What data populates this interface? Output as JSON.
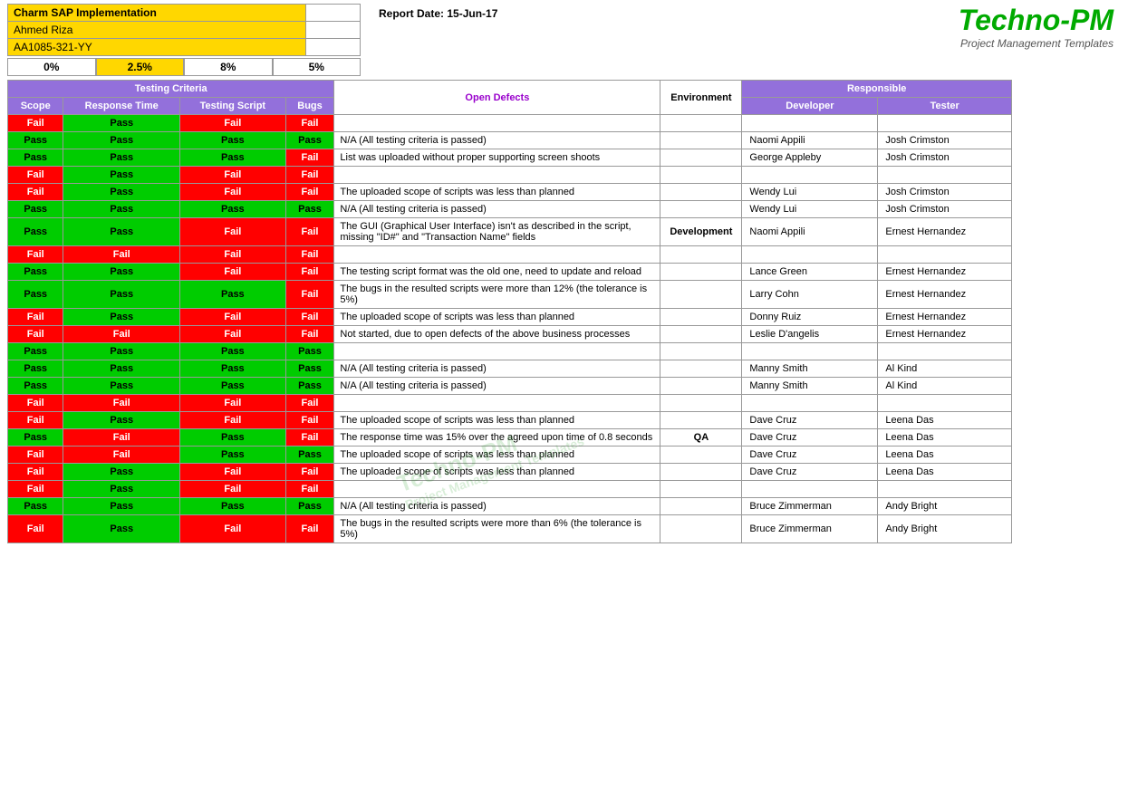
{
  "header": {
    "project_name": "Charm SAP Implementation",
    "person": "Ahmed Riza",
    "id": "AA1085-321-YY",
    "report_date_label": "Report Date:",
    "report_date_value": "15-Jun-17"
  },
  "brand": {
    "title": "Techno-PM",
    "subtitle": "Project Management Templates"
  },
  "percentages": [
    "0%",
    "2.5%",
    "8%",
    "5%"
  ],
  "table": {
    "testing_criteria_label": "Testing Criteria",
    "open_defects_label": "Open Defects",
    "environment_label": "Environment",
    "responsible_label": "Responsible",
    "col_headers": [
      "Scope",
      "Response Time",
      "Testing Script",
      "Bugs"
    ],
    "developer_label": "Developer",
    "tester_label": "Tester",
    "rows": [
      {
        "scope": "Fail",
        "response": "Pass",
        "script": "Fail",
        "bugs": "Fail",
        "defect": "",
        "environment": "",
        "developer": "",
        "tester": "",
        "row_class": "header-row"
      },
      {
        "scope": "Pass",
        "response": "Pass",
        "script": "Pass",
        "bugs": "Pass",
        "defect": "N/A (All testing criteria is passed)",
        "environment": "",
        "developer": "Naomi Appili",
        "tester": "Josh Crimston"
      },
      {
        "scope": "Pass",
        "response": "Pass",
        "script": "Pass",
        "bugs": "Fail",
        "defect": "List was uploaded without proper supporting screen shoots",
        "environment": "",
        "developer": "George Appleby",
        "tester": "Josh Crimston"
      },
      {
        "scope": "Fail",
        "response": "Pass",
        "script": "Fail",
        "bugs": "Fail",
        "defect": "",
        "environment": "",
        "developer": "",
        "tester": ""
      },
      {
        "scope": "Fail",
        "response": "Pass",
        "script": "Fail",
        "bugs": "Fail",
        "defect": "The uploaded scope of scripts was less than planned",
        "environment": "",
        "developer": "Wendy Lui",
        "tester": "Josh Crimston"
      },
      {
        "scope": "Pass",
        "response": "Pass",
        "script": "Pass",
        "bugs": "Pass",
        "defect": "N/A (All testing criteria is passed)",
        "environment": "",
        "developer": "Wendy Lui",
        "tester": "Josh Crimston"
      },
      {
        "scope": "Pass",
        "response": "Pass",
        "script": "Fail",
        "bugs": "Fail",
        "defect": "The GUI (Graphical User Interface) isn't as described in the script, missing \"ID#\" and \"Transaction Name\" fields",
        "environment": "Development",
        "developer": "Naomi Appili",
        "tester": "Ernest Hernandez"
      },
      {
        "scope": "Fail",
        "response": "Fail",
        "script": "Fail",
        "bugs": "Fail",
        "defect": "",
        "environment": "",
        "developer": "",
        "tester": ""
      },
      {
        "scope": "Pass",
        "response": "Pass",
        "script": "Fail",
        "bugs": "Fail",
        "defect": "The testing script format was the old one, need to update and reload",
        "environment": "",
        "developer": "Lance Green",
        "tester": "Ernest Hernandez"
      },
      {
        "scope": "Pass",
        "response": "Pass",
        "script": "Pass",
        "bugs": "Fail",
        "defect": "The bugs in the resulted scripts were more than 12% (the tolerance is 5%)",
        "environment": "",
        "developer": "Larry Cohn",
        "tester": "Ernest Hernandez"
      },
      {
        "scope": "Fail",
        "response": "Pass",
        "script": "Fail",
        "bugs": "Fail",
        "defect": "The uploaded scope of scripts was less than planned",
        "environment": "",
        "developer": "Donny Ruiz",
        "tester": "Ernest Hernandez"
      },
      {
        "scope": "Fail",
        "response": "Fail",
        "script": "Fail",
        "bugs": "Fail",
        "defect": "Not started, due to open defects of the above business processes",
        "environment": "",
        "developer": "Leslie D'angelis",
        "tester": "Ernest Hernandez"
      },
      {
        "scope": "Pass",
        "response": "Pass",
        "script": "Pass",
        "bugs": "Pass",
        "defect": "",
        "environment": "",
        "developer": "",
        "tester": "",
        "bold": true
      },
      {
        "scope": "Pass",
        "response": "Pass",
        "script": "Pass",
        "bugs": "Pass",
        "defect": "N/A (All testing criteria is passed)",
        "environment": "",
        "developer": "Manny Smith",
        "tester": "Al Kind"
      },
      {
        "scope": "Pass",
        "response": "Pass",
        "script": "Pass",
        "bugs": "Pass",
        "defect": "N/A (All testing criteria is passed)",
        "environment": "",
        "developer": "Manny Smith",
        "tester": "Al Kind"
      },
      {
        "scope": "Fail",
        "response": "Fail",
        "script": "Fail",
        "bugs": "Fail",
        "defect": "",
        "environment": "",
        "developer": "",
        "tester": ""
      },
      {
        "scope": "Fail",
        "response": "Pass",
        "script": "Fail",
        "bugs": "Fail",
        "defect": "The uploaded scope of scripts was less than planned",
        "environment": "",
        "developer": "Dave Cruz",
        "tester": "Leena Das"
      },
      {
        "scope": "Pass",
        "response": "Fail",
        "script": "Pass",
        "bugs": "Fail",
        "defect": "The response time was 15% over the agreed upon time of 0.8 seconds",
        "environment": "QA",
        "developer": "Dave Cruz",
        "tester": "Leena Das"
      },
      {
        "scope": "Fail",
        "response": "Fail",
        "script": "Pass",
        "bugs": "Pass",
        "defect": "The uploaded scope of scripts was less than planned",
        "environment": "",
        "developer": "Dave Cruz",
        "tester": "Leena Das"
      },
      {
        "scope": "Fail",
        "response": "Pass",
        "script": "Fail",
        "bugs": "Fail",
        "defect": "The uploaded scope of scripts was less than planned",
        "environment": "",
        "developer": "Dave Cruz",
        "tester": "Leena Das"
      },
      {
        "scope": "Fail",
        "response": "Pass",
        "script": "Fail",
        "bugs": "Fail",
        "defect": "",
        "environment": "",
        "developer": "",
        "tester": ""
      },
      {
        "scope": "Pass",
        "response": "Pass",
        "script": "Pass",
        "bugs": "Pass",
        "defect": "N/A (All testing criteria is passed)",
        "environment": "",
        "developer": "Bruce Zimmerman",
        "tester": "Andy Bright"
      },
      {
        "scope": "Fail",
        "response": "Pass",
        "script": "Fail",
        "bugs": "Fail",
        "defect": "The bugs in the resulted scripts were more than 6% (the tolerance is 5%)",
        "environment": "",
        "developer": "Bruce Zimmerman",
        "tester": "Andy Bright"
      }
    ]
  }
}
